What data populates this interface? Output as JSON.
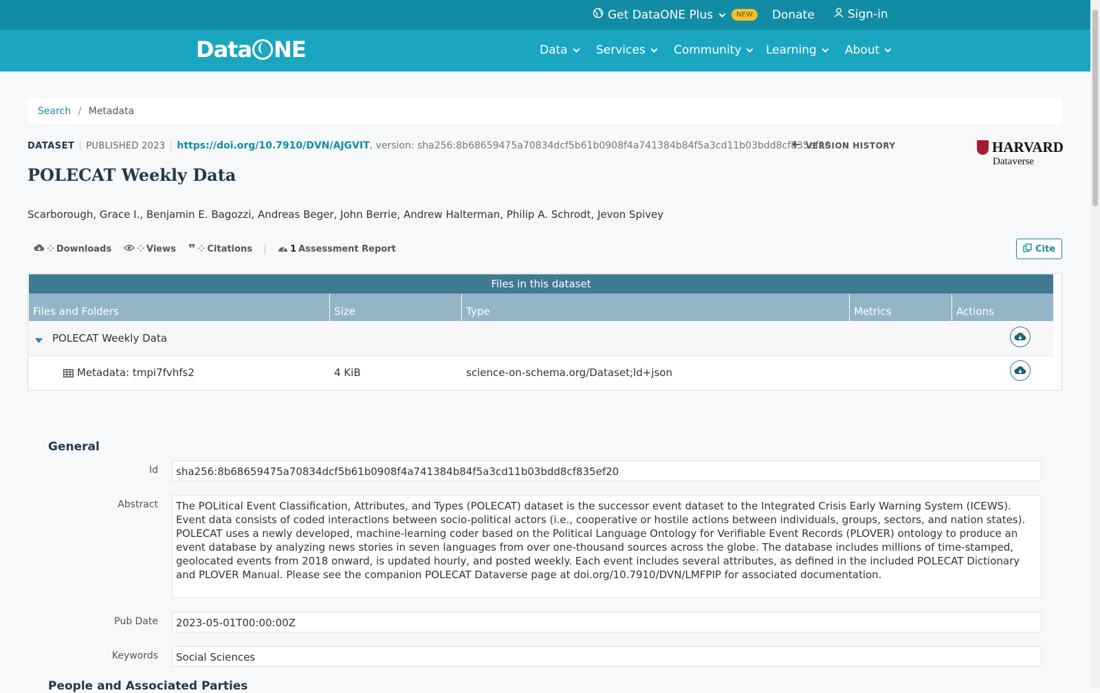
{
  "topbar": {
    "plus_label": "Get DataONE Plus",
    "new_badge": "NEW",
    "donate": "Donate",
    "signin": "Sign-in"
  },
  "navbar": {
    "logo": {
      "data": "Data",
      "one": "NE"
    },
    "items": [
      "Data",
      "Services",
      "Community",
      "Learning",
      "About"
    ]
  },
  "breadcrumb": {
    "search": "Search",
    "sep": "/",
    "current": "Metadata"
  },
  "dataset": {
    "type_label": "DATASET",
    "published": "PUBLISHED 2023",
    "doi": "https://doi.org/10.7910/DVN/AJGVIT",
    "version_text": ", version: sha256:8b68659475a70834dcf5b61b0908f4a741384b84f5a3cd11b03bdd8cf835ef20",
    "version_history": "VERSION HISTORY",
    "repository": {
      "name": "HARVARD",
      "sub": "Dataverse"
    },
    "title": "POLECAT Weekly Data",
    "authors": "Scarborough, Grace I., Benjamin E. Bagozzi, Andreas Beger, John Berrie, Andrew Halterman, Philip A. Schrodt, Jevon Spivey"
  },
  "stats": {
    "downloads": "Downloads",
    "views": "Views",
    "citations": "Citations",
    "assessment_count": "1",
    "assessment_label": "Assessment Report",
    "cite_button": "Cite"
  },
  "files": {
    "header": "Files in this dataset",
    "columns": [
      "Files and Folders",
      "Size",
      "Type",
      "Metrics",
      "Actions"
    ],
    "folder": {
      "name": "POLECAT Weekly Data"
    },
    "rows": [
      {
        "name": "Metadata: tmpi7fvhfs2",
        "size": "4 KiB",
        "type": "science-on-schema.org/Dataset;ld+json"
      }
    ]
  },
  "general": {
    "title": "General",
    "fields": {
      "id_label": "Id",
      "id_value": "sha256:8b68659475a70834dcf5b61b0908f4a741384b84f5a3cd11b03bdd8cf835ef20",
      "abstract_label": "Abstract",
      "abstract_value": "The POLitical Event Classification, Attributes, and Types (POLECAT) dataset is the successor event dataset to the Integrated Crisis Early Warning System (ICEWS). Event data consists of coded interactions between socio-political actors (i.e., cooperative or hostile actions between individuals, groups, sectors, and nation states). POLECAT uses a newly developed, machine-learning coder based on the Political Language Ontology for Verifiable Event Records (PLOVER) ontology to produce an event database by analyzing news stories in seven languages from over one-thousand sources across the globe. The database includes millions of time-stamped, geolocated events from 2018 onward, is updated hourly, and posted weekly. Each event includes several attributes, as defined in the included POLECAT Dictionary and PLOVER Manual. Please see the companion POLECAT Dataverse page at doi.org/10.7910/DVN/LMFPIP for associated documentation.",
      "pubdate_label": "Pub Date",
      "pubdate_value": "2023-05-01T00:00:00Z",
      "keywords_label": "Keywords",
      "keywords_value": "Social Sciences"
    }
  },
  "next_section": "People and Associated Parties",
  "colors": {
    "topbar": "#128ca4",
    "navbar": "#1aa6c1",
    "accent": "#128ca4",
    "title": "#1f3a4d"
  },
  "icons": [
    "globe-icon",
    "chevron-down-icon",
    "user-icon",
    "arrow-left-icon",
    "download-cloud-icon",
    "eye-icon",
    "quote-icon",
    "gauge-icon",
    "copy-icon",
    "caret-down-icon",
    "table-icon"
  ]
}
